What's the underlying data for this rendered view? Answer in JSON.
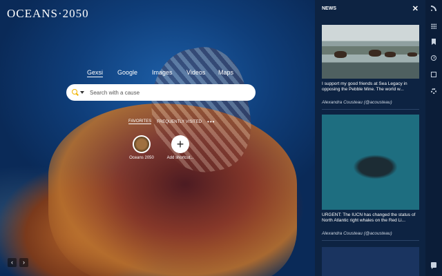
{
  "logo": {
    "text": "OCEANS·2050"
  },
  "search": {
    "tabs": [
      "Gexsi",
      "Google",
      "Images",
      "Videos",
      "Maps"
    ],
    "active_tab": "Gexsi",
    "placeholder": "Search with a cause"
  },
  "shortcuts": {
    "tabs": [
      "FAVORITES",
      "FREQUENTLY VISITED"
    ],
    "more": "•••",
    "tiles": [
      {
        "label": "Oceans 2050"
      },
      {
        "label": "Add shortcut..."
      }
    ]
  },
  "nav_arrows": {
    "prev": "‹",
    "next": "›"
  },
  "news": {
    "title": "NEWS",
    "close": "✕",
    "cards": [
      {
        "text": "I support my good friends at Sea Legacy in opposing the Pebble Mine. The world w...",
        "author": "Alexandra Cousteau (@acousteau)"
      },
      {
        "text": "URGENT: The IUCN has changed the status of North Atlantic right whales on the Red Li...",
        "author": "Alexandra Cousteau (@acousteau)"
      }
    ]
  },
  "sidebar": {
    "icons": [
      "rss-icon",
      "apps-grid-icon",
      "bookmark-icon",
      "history-clock-icon",
      "edit-note-icon",
      "settings-gear-icon",
      "feedback-icon"
    ]
  }
}
